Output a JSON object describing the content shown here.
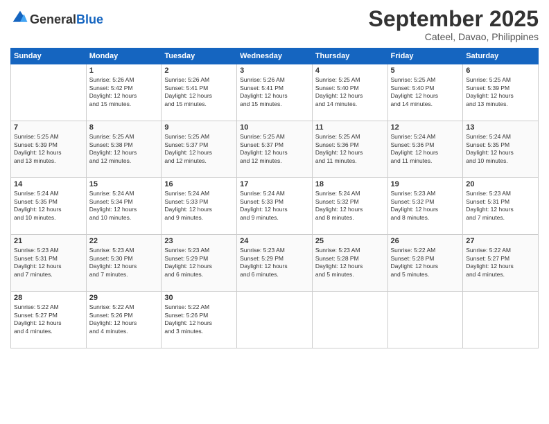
{
  "header": {
    "logo_line1": "General",
    "logo_line2": "Blue",
    "month": "September 2025",
    "location": "Cateel, Davao, Philippines"
  },
  "days": [
    "Sunday",
    "Monday",
    "Tuesday",
    "Wednesday",
    "Thursday",
    "Friday",
    "Saturday"
  ],
  "weeks": [
    [
      {
        "date": "",
        "info": ""
      },
      {
        "date": "1",
        "info": "Sunrise: 5:26 AM\nSunset: 5:42 PM\nDaylight: 12 hours\nand 15 minutes."
      },
      {
        "date": "2",
        "info": "Sunrise: 5:26 AM\nSunset: 5:41 PM\nDaylight: 12 hours\nand 15 minutes."
      },
      {
        "date": "3",
        "info": "Sunrise: 5:26 AM\nSunset: 5:41 PM\nDaylight: 12 hours\nand 15 minutes."
      },
      {
        "date": "4",
        "info": "Sunrise: 5:25 AM\nSunset: 5:40 PM\nDaylight: 12 hours\nand 14 minutes."
      },
      {
        "date": "5",
        "info": "Sunrise: 5:25 AM\nSunset: 5:40 PM\nDaylight: 12 hours\nand 14 minutes."
      },
      {
        "date": "6",
        "info": "Sunrise: 5:25 AM\nSunset: 5:39 PM\nDaylight: 12 hours\nand 13 minutes."
      }
    ],
    [
      {
        "date": "7",
        "info": "Sunrise: 5:25 AM\nSunset: 5:39 PM\nDaylight: 12 hours\nand 13 minutes."
      },
      {
        "date": "8",
        "info": "Sunrise: 5:25 AM\nSunset: 5:38 PM\nDaylight: 12 hours\nand 12 minutes."
      },
      {
        "date": "9",
        "info": "Sunrise: 5:25 AM\nSunset: 5:37 PM\nDaylight: 12 hours\nand 12 minutes."
      },
      {
        "date": "10",
        "info": "Sunrise: 5:25 AM\nSunset: 5:37 PM\nDaylight: 12 hours\nand 12 minutes."
      },
      {
        "date": "11",
        "info": "Sunrise: 5:25 AM\nSunset: 5:36 PM\nDaylight: 12 hours\nand 11 minutes."
      },
      {
        "date": "12",
        "info": "Sunrise: 5:24 AM\nSunset: 5:36 PM\nDaylight: 12 hours\nand 11 minutes."
      },
      {
        "date": "13",
        "info": "Sunrise: 5:24 AM\nSunset: 5:35 PM\nDaylight: 12 hours\nand 10 minutes."
      }
    ],
    [
      {
        "date": "14",
        "info": "Sunrise: 5:24 AM\nSunset: 5:35 PM\nDaylight: 12 hours\nand 10 minutes."
      },
      {
        "date": "15",
        "info": "Sunrise: 5:24 AM\nSunset: 5:34 PM\nDaylight: 12 hours\nand 10 minutes."
      },
      {
        "date": "16",
        "info": "Sunrise: 5:24 AM\nSunset: 5:33 PM\nDaylight: 12 hours\nand 9 minutes."
      },
      {
        "date": "17",
        "info": "Sunrise: 5:24 AM\nSunset: 5:33 PM\nDaylight: 12 hours\nand 9 minutes."
      },
      {
        "date": "18",
        "info": "Sunrise: 5:24 AM\nSunset: 5:32 PM\nDaylight: 12 hours\nand 8 minutes."
      },
      {
        "date": "19",
        "info": "Sunrise: 5:23 AM\nSunset: 5:32 PM\nDaylight: 12 hours\nand 8 minutes."
      },
      {
        "date": "20",
        "info": "Sunrise: 5:23 AM\nSunset: 5:31 PM\nDaylight: 12 hours\nand 7 minutes."
      }
    ],
    [
      {
        "date": "21",
        "info": "Sunrise: 5:23 AM\nSunset: 5:31 PM\nDaylight: 12 hours\nand 7 minutes."
      },
      {
        "date": "22",
        "info": "Sunrise: 5:23 AM\nSunset: 5:30 PM\nDaylight: 12 hours\nand 7 minutes."
      },
      {
        "date": "23",
        "info": "Sunrise: 5:23 AM\nSunset: 5:29 PM\nDaylight: 12 hours\nand 6 minutes."
      },
      {
        "date": "24",
        "info": "Sunrise: 5:23 AM\nSunset: 5:29 PM\nDaylight: 12 hours\nand 6 minutes."
      },
      {
        "date": "25",
        "info": "Sunrise: 5:23 AM\nSunset: 5:28 PM\nDaylight: 12 hours\nand 5 minutes."
      },
      {
        "date": "26",
        "info": "Sunrise: 5:22 AM\nSunset: 5:28 PM\nDaylight: 12 hours\nand 5 minutes."
      },
      {
        "date": "27",
        "info": "Sunrise: 5:22 AM\nSunset: 5:27 PM\nDaylight: 12 hours\nand 4 minutes."
      }
    ],
    [
      {
        "date": "28",
        "info": "Sunrise: 5:22 AM\nSunset: 5:27 PM\nDaylight: 12 hours\nand 4 minutes."
      },
      {
        "date": "29",
        "info": "Sunrise: 5:22 AM\nSunset: 5:26 PM\nDaylight: 12 hours\nand 4 minutes."
      },
      {
        "date": "30",
        "info": "Sunrise: 5:22 AM\nSunset: 5:26 PM\nDaylight: 12 hours\nand 3 minutes."
      },
      {
        "date": "",
        "info": ""
      },
      {
        "date": "",
        "info": ""
      },
      {
        "date": "",
        "info": ""
      },
      {
        "date": "",
        "info": ""
      }
    ]
  ]
}
